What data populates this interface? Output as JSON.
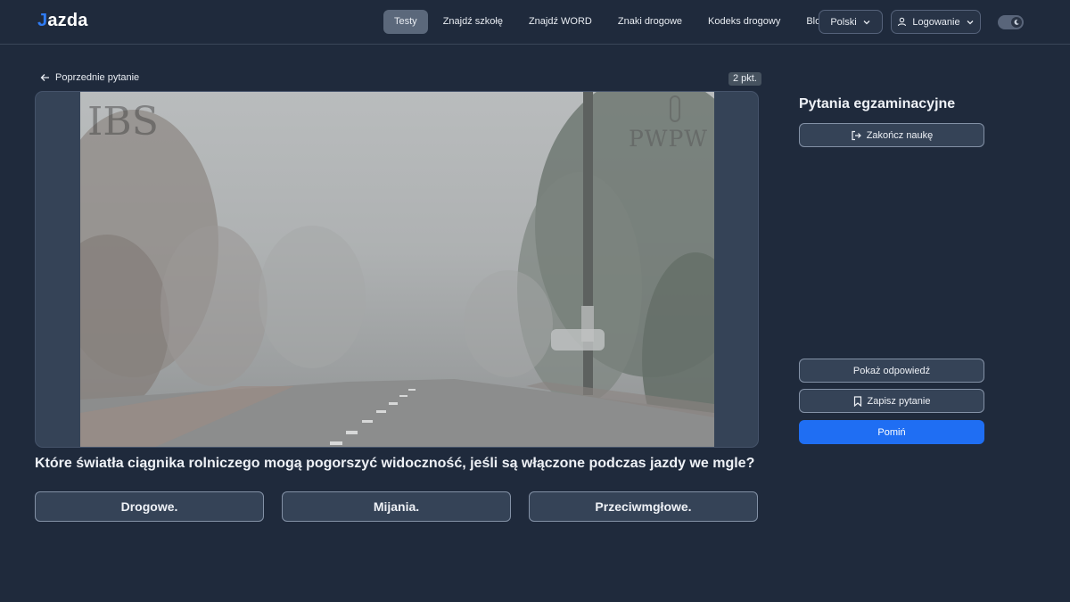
{
  "header": {
    "logo": {
      "mark": "J",
      "rest": "azda"
    },
    "nav": [
      "Testy",
      "Znajdź szkołę",
      "Znajdź WORD",
      "Znaki drogowe",
      "Kodeks drogowy",
      "Blog"
    ],
    "active_nav": "Testy",
    "language": {
      "label": "Polski",
      "icon": "chevron-down-icon"
    },
    "login": {
      "label": "Logowanie",
      "icons": [
        "user-icon",
        "chevron-down-icon"
      ]
    },
    "theme_toggle": {
      "icon": "moon-icon",
      "state": "dark"
    }
  },
  "question": {
    "back_label": "Poprzednie pytanie",
    "points": "2 pkt.",
    "media": {
      "description_icon": "fog-road-photo",
      "watermark_left": "IBS",
      "watermark_right": "PWPW"
    },
    "text": "Które światła ciągnika rolniczego mogą pogorszyć widoczność, jeśli są włączone podczas jazdy we mgle?",
    "answers": [
      "Drogowe.",
      "Mijania.",
      "Przeciwmgłowe."
    ]
  },
  "sidebar": {
    "title": "Pytania egzaminacyjne",
    "end_label": "Zakończ naukę",
    "show_answer_label": "Pokaż odpowiedź",
    "save_label": "Zapisz pytanie",
    "skip_label": "Pomiń",
    "colors": {
      "primary": "#1f6ef3",
      "background": "#1f2a3c"
    }
  }
}
